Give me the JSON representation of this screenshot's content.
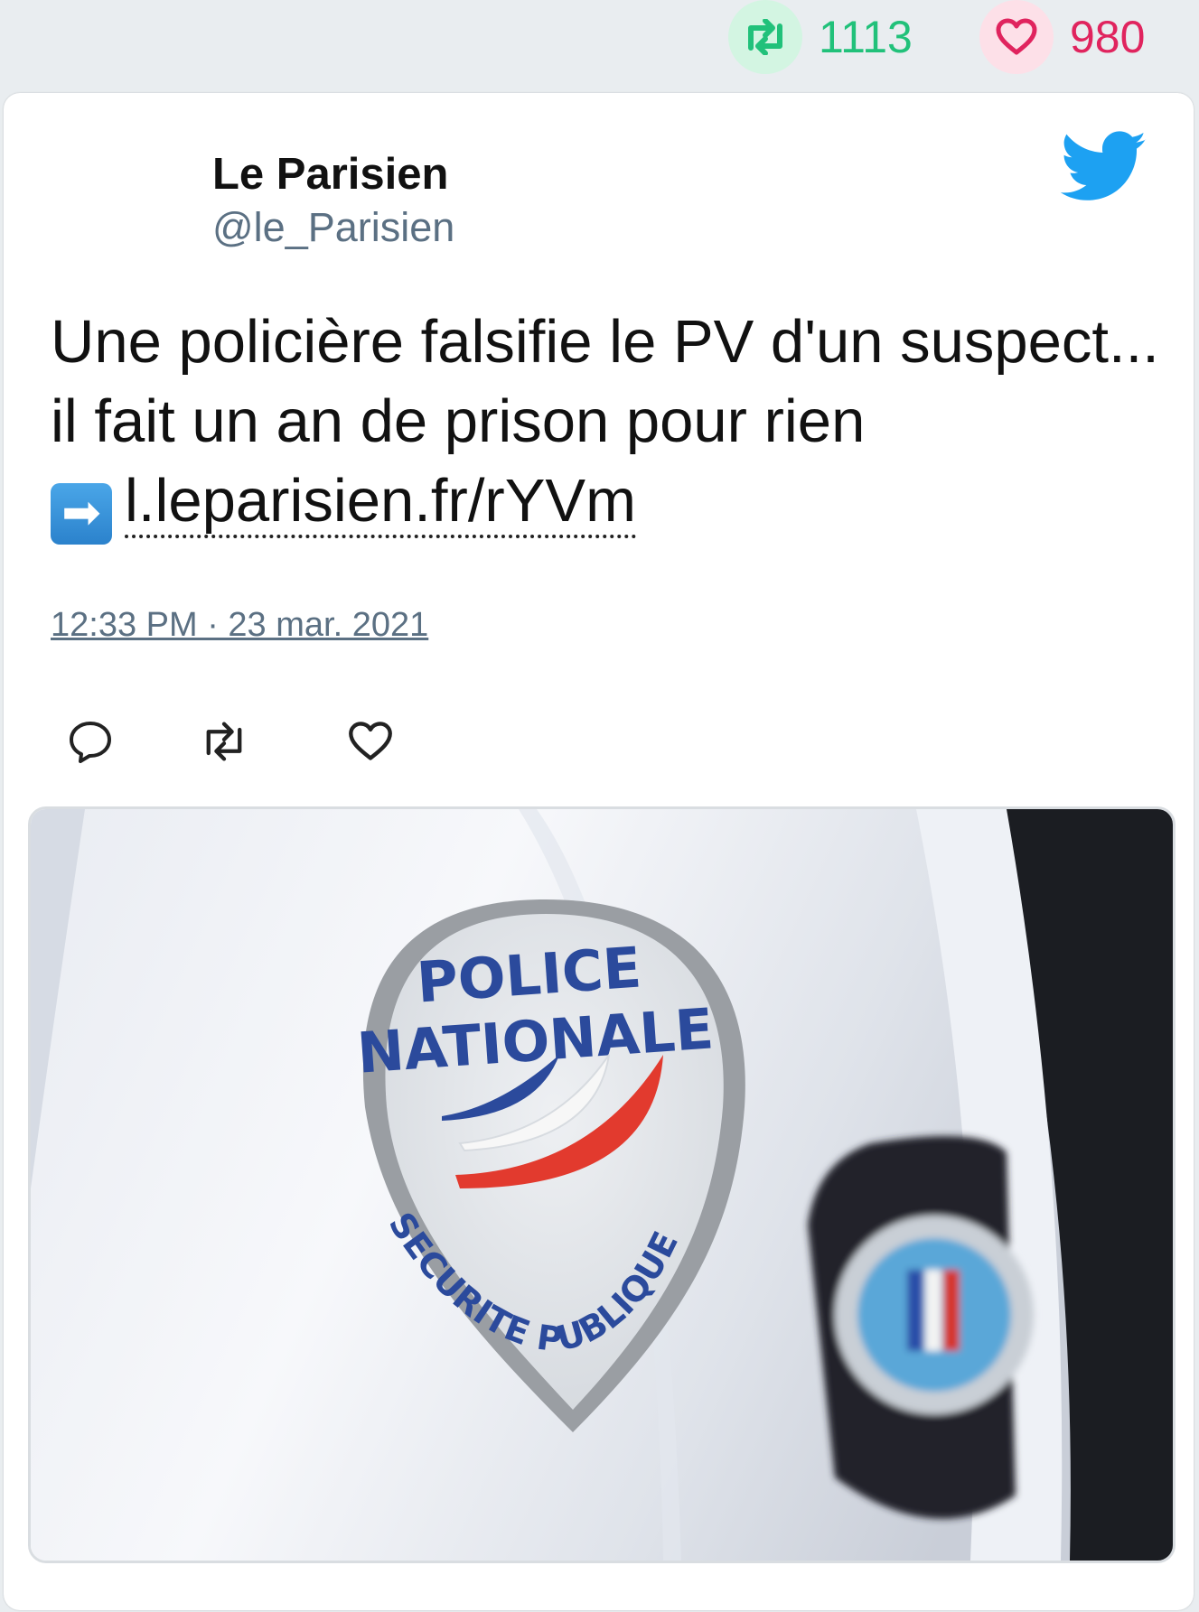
{
  "stats": {
    "retweets": "1113",
    "likes": "980",
    "retweet_color": "#21c17a",
    "like_color": "#e0245e"
  },
  "tweet": {
    "author_name": "Le Parisien",
    "author_handle": "@le_Parisien",
    "text": "Une policière falsifie le PV d'un suspect... il fait un an de prison pour rien",
    "arrow_emoji": "➡",
    "link": "l.leparisien.fr/rYVm",
    "timestamp": "12:33 PM · 23 mar. 2021",
    "brand_icon": "twitter-bird-icon",
    "brand_color": "#1da1f2"
  },
  "actions": {
    "icons": [
      "reply-icon",
      "retweet-icon",
      "like-icon"
    ]
  },
  "media": {
    "patch_line1": "POLICE",
    "patch_line2": "NATIONALE",
    "patch_arc": "SECURITE PUBLIQUE"
  }
}
